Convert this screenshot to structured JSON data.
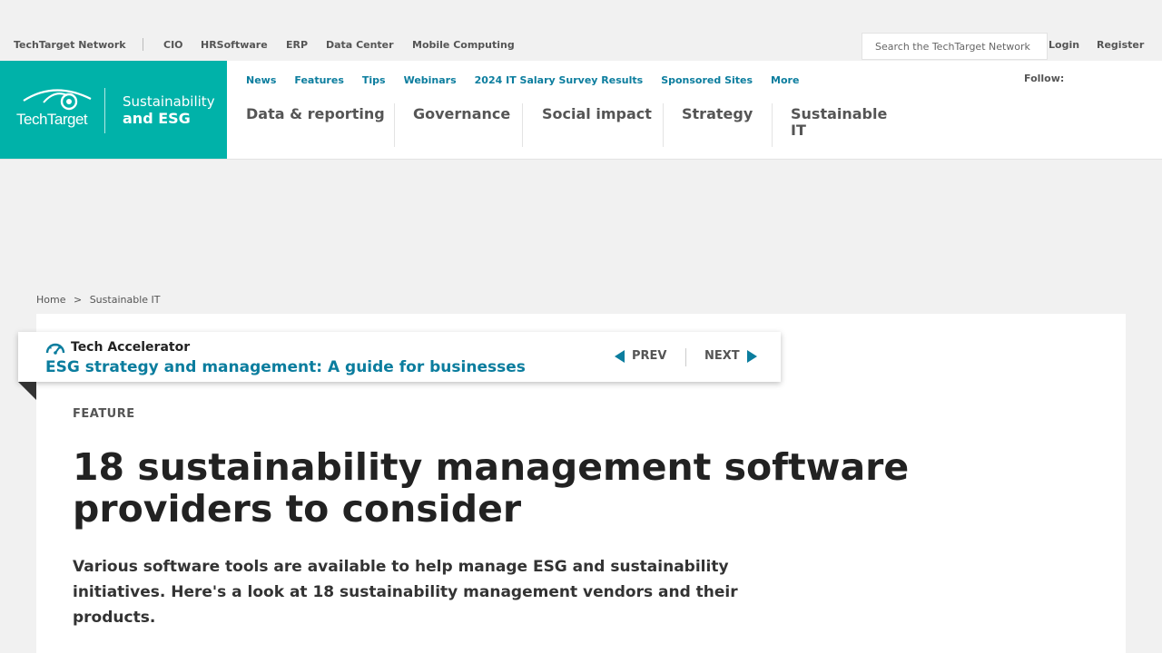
{
  "network_bar": {
    "items": [
      "TechTarget Network",
      "CIO",
      "HRSoftware",
      "ERP",
      "Data Center",
      "Mobile Computing"
    ],
    "search_placeholder": "Search the TechTarget Network",
    "login": "Login",
    "register": "Register"
  },
  "brand": {
    "logo_text": "TechTarget",
    "site_line1": "Sustainability",
    "site_line2": "and ESG",
    "color": "#00b2a9"
  },
  "subnav": {
    "items": [
      "News",
      "Features",
      "Tips",
      "Webinars",
      "2024 IT Salary Survey Results",
      "Sponsored Sites",
      "More"
    ],
    "follow": "Follow:"
  },
  "topics": [
    "Data & reporting",
    "Governance",
    "Social impact",
    "Strategy",
    "Sustainable IT"
  ],
  "breadcrumb": {
    "home": "Home",
    "separator": ">",
    "current": "Sustainable IT"
  },
  "accelerator": {
    "label": "Tech Accelerator",
    "title": "ESG strategy and management: A guide for businesses",
    "prev": "PREV",
    "next": "NEXT",
    "accent": "#0b7d9e"
  },
  "article": {
    "kicker": "FEATURE",
    "headline": "18 sustainability management software providers to consider",
    "dek": "Various software tools are available to help manage ESG and sustainability initiatives. Here's a look at 18 sustainability management vendors and their products."
  }
}
